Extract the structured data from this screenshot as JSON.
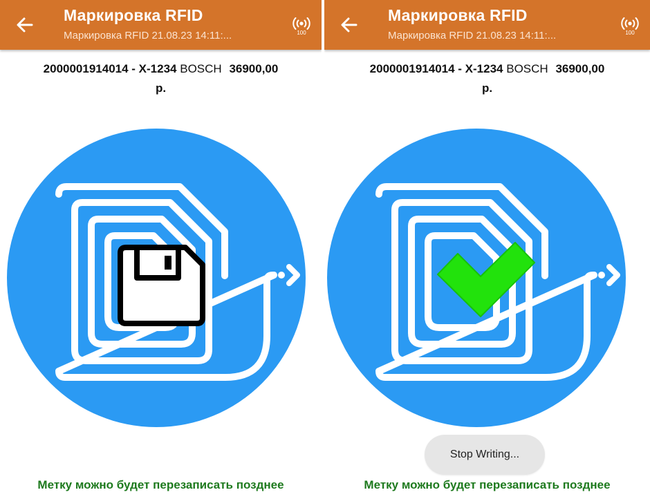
{
  "screens": [
    {
      "app_bar": {
        "title": "Маркировка RFID",
        "subtitle": "Маркировка RFID 21.08.23 14:11:...",
        "rfid_level": "100",
        "back_icon": "arrow-left-icon",
        "status_icon": "rfid-signal-icon"
      },
      "product": {
        "barcode_name": "2000001914014 - X-1234",
        "brand": "BOSCH",
        "price": "36900,00",
        "currency": "р."
      },
      "illustration": {
        "state": "writing",
        "icon": "floppy-disk-icon"
      },
      "footer_note": "Метку можно будет перезаписать позднее"
    },
    {
      "app_bar": {
        "title": "Маркировка RFID",
        "subtitle": "Маркировка RFID 21.08.23 14:11:...",
        "rfid_level": "100",
        "back_icon": "arrow-left-icon",
        "status_icon": "rfid-signal-icon"
      },
      "product": {
        "barcode_name": "2000001914014 - X-1234",
        "brand": "BOSCH",
        "price": "36900,00",
        "currency": "р."
      },
      "illustration": {
        "state": "success",
        "icon": "checkmark-icon"
      },
      "toast": "Stop Writing...",
      "footer_note": "Метку можно будет перезаписать позднее"
    }
  ],
  "colors": {
    "app_bar": "#d4742a",
    "circle": "#2b9af3",
    "success_check": "#22e20c",
    "footer_text": "#1e7a1e",
    "toast_bg": "#e6e6e6"
  }
}
